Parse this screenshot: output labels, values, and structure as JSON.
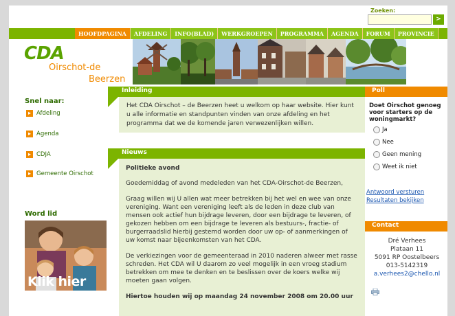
{
  "search": {
    "label": "Zoeken:",
    "value": "",
    "button": ">"
  },
  "nav": [
    {
      "label": "HOOFDPAGINA",
      "active": true
    },
    {
      "label": "AFDELING",
      "active": false
    },
    {
      "label": "INFO(BLAD)",
      "active": false
    },
    {
      "label": "WERKGROEPEN",
      "active": false
    },
    {
      "label": "PROGRAMMA",
      "active": false
    },
    {
      "label": "AGENDA",
      "active": false
    },
    {
      "label": "FORUM",
      "active": false
    },
    {
      "label": "PROVINCIE",
      "active": false
    }
  ],
  "logo": {
    "name": "CDA",
    "line1": "Oirschot-de",
    "line2": "Beerzen"
  },
  "sidebar": {
    "title": "Snel naar:",
    "items": [
      {
        "label": "Afdeling"
      },
      {
        "label": "Agenda"
      },
      {
        "label": "CDJA"
      },
      {
        "label": "Gemeente Oirschot"
      }
    ],
    "join_title": "Word lid",
    "join_cta": "Klik hier"
  },
  "intro": {
    "title": "Inleiding",
    "text": "Het CDA Oirschot – de Beerzen heet u welkom op haar website. Hier kunt u alle informatie en standpunten vinden van onze afdeling en het programma dat we de komende jaren verwezenlijken willen."
  },
  "news": {
    "title": "Nieuws",
    "headline": "Politieke avond",
    "paragraphs": [
      "Goedemiddag of avond medeleden van het CDA-Oirschot-de Beerzen,",
      "Graag willen wij U allen wat meer betrekken bij het wel en wee van onze vereniging. Want een vereniging leeft als de leden in deze club van mensen ook actief hun bijdrage leveren, door een bijdrage te leveren, of gekozen hebben om een bijdrage te leveren als bestuurs-, fractie- of burgerraadslid hierbij gestemd worden door uw op- of aanmerkingen of uw komst naar bijeenkomsten van het CDA.",
      "De verkiezingen voor de gemeenteraad in 2010 naderen alweer met rasse schreden. Het CDA wil U daarom zo veel mogelijk in een vroeg stadium betrekken om mee te denken en te beslissen over de koers welke wij moeten gaan volgen."
    ],
    "teaser": "Hiertoe houden wij op maandag 24 november 2008 om 20.00 uur"
  },
  "poll": {
    "title": "Poll",
    "question": "Doet Oirschot genoeg voor starters op de woningmarkt?",
    "options": [
      "Ja",
      "Nee",
      "Geen mening",
      "Weet ik niet"
    ],
    "submit_link": "Antwoord versturen",
    "results_link": "Resultaten bekijken"
  },
  "contact": {
    "title": "Contact",
    "name": "Dré Verhees",
    "street": "Plataan 11",
    "city": "5091 RP Oostelbeers",
    "phone": "013-5142319",
    "email": "a.verhees2@chello.nl"
  },
  "colors": {
    "green": "#7cb400",
    "orange": "#f08a00",
    "content_bg": "#e8f0d4"
  },
  "icons": {
    "print": "print-icon",
    "nav_arrow": "orange-arrow-icon"
  }
}
